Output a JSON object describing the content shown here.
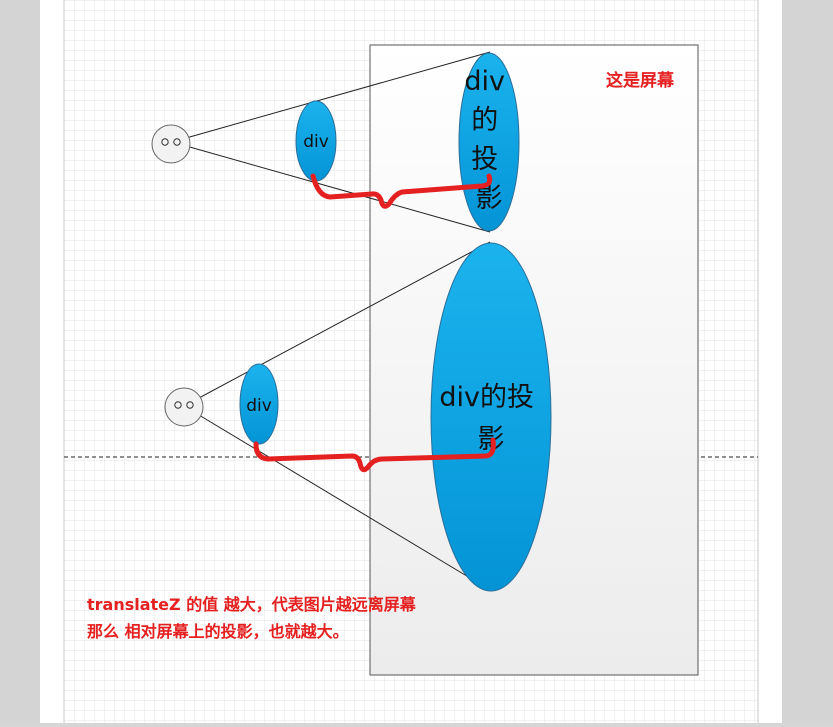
{
  "diagram": {
    "screen_label": "这是屏幕",
    "near_div_label": "div",
    "near_projection_lines": [
      "div",
      "的",
      "投",
      "影"
    ],
    "far_div_label": "div",
    "far_projection_lines": [
      "div的投",
      "影"
    ],
    "caption_lines": [
      "translateZ 的值 越大，代表图片越远离屏幕",
      "那么 相对屏幕上的投影，也就越大。"
    ]
  },
  "colors": {
    "page_background": "#d6d6d6",
    "paper": "#ffffff",
    "grid_line": "#e2e2e2",
    "ellipse_fill": "#0aa2e0",
    "ellipse_stroke": "#2a6f9a",
    "connector": "#e52020",
    "label_red": "#e52020"
  }
}
